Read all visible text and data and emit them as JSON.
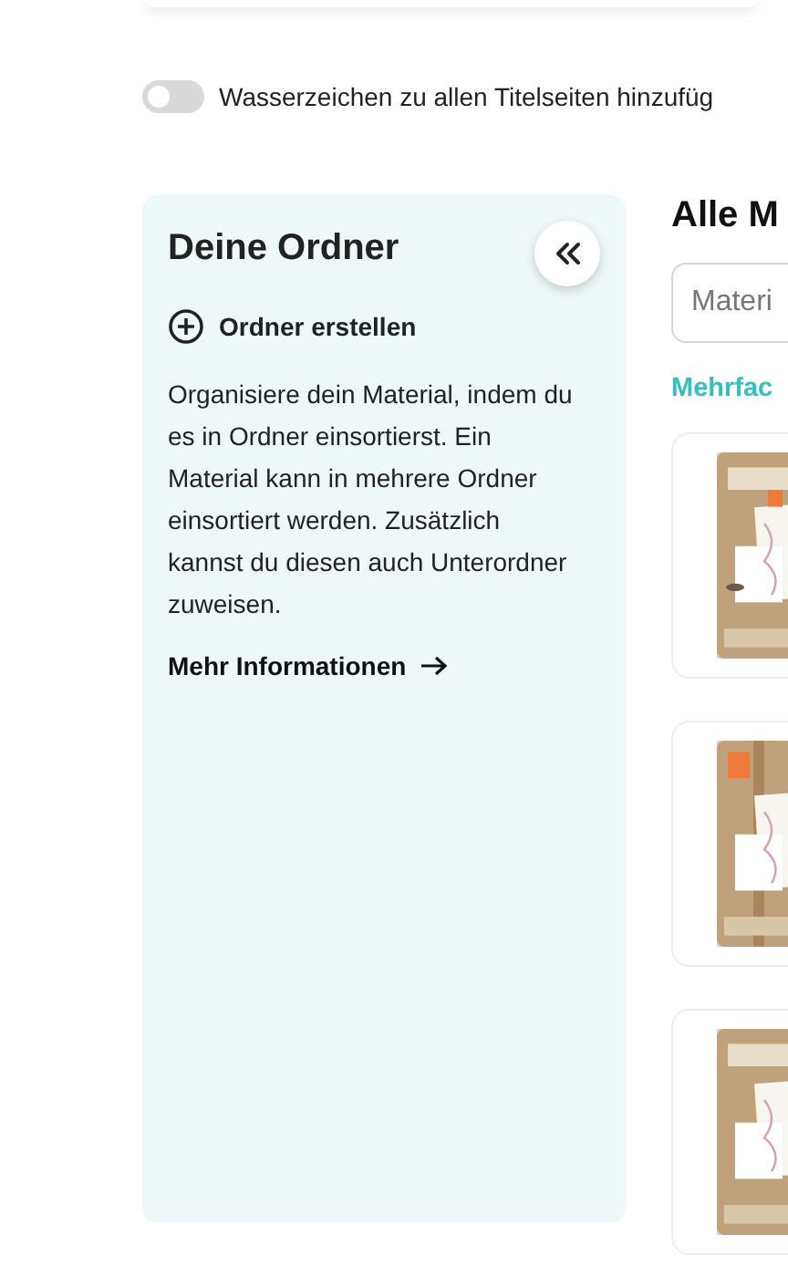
{
  "watermark_toggle": {
    "label": "Wasserzeichen zu allen Titelseiten hinzufüg",
    "on": false
  },
  "sidebar": {
    "title": "Deine Ordner",
    "create_button": "Ordner erstellen",
    "description": "Organisiere dein Material, indem du es in Ordner einsortierst. Ein Material kann in mehrere Ordner einsortiert werden. Zusätzlich kannst du diesen auch Unterordner zuweisen.",
    "more_link": "Mehr Informationen"
  },
  "main": {
    "title": "Alle M",
    "search": {
      "placeholder": "Materi"
    },
    "section_link": "Mehrfac"
  }
}
